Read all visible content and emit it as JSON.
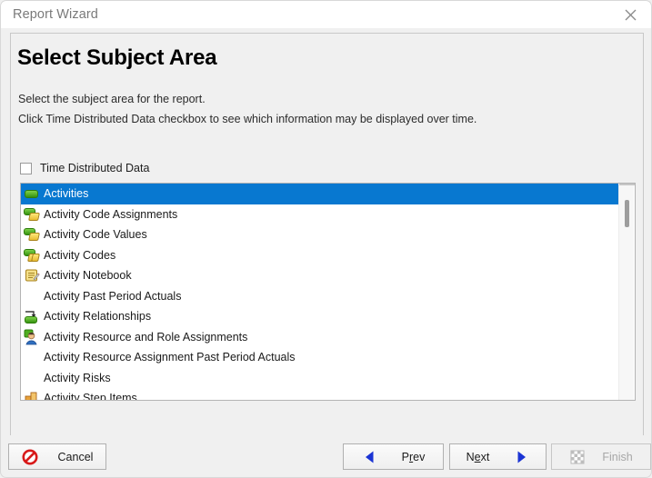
{
  "window": {
    "title": "Report Wizard",
    "close_icon": "close-icon"
  },
  "page": {
    "heading": "Select Subject Area",
    "instruction_line_1": "Select the subject area for the report.",
    "instruction_line_2": "Click Time Distributed Data checkbox to see which information may be displayed over time."
  },
  "checkbox": {
    "label": "Time Distributed Data",
    "checked": false
  },
  "list": {
    "selected_index": 0,
    "items": [
      {
        "label": "Activities",
        "icon": "activity-bar-icon",
        "selected": true
      },
      {
        "label": "Activity Code Assignments",
        "icon": "activity-code-assignment-icon",
        "selected": false
      },
      {
        "label": "Activity Code Values",
        "icon": "activity-code-value-icon",
        "selected": false
      },
      {
        "label": "Activity Codes",
        "icon": "activity-code-icon",
        "selected": false
      },
      {
        "label": "Activity Notebook",
        "icon": "notebook-icon",
        "selected": false
      },
      {
        "label": "Activity Past Period Actuals",
        "icon": "none",
        "selected": false
      },
      {
        "label": "Activity Relationships",
        "icon": "relationship-icon",
        "selected": false
      },
      {
        "label": "Activity Resource and Role Assignments",
        "icon": "resource-role-icon",
        "selected": false
      },
      {
        "label": "Activity Resource Assignment Past Period Actuals",
        "icon": "none",
        "selected": false
      },
      {
        "label": "Activity Risks",
        "icon": "none",
        "selected": false
      },
      {
        "label": "Activity Step Items",
        "icon": "step-item-icon",
        "selected": false
      }
    ]
  },
  "buttons": {
    "cancel": {
      "label": "Cancel",
      "icon": "cancel-prohibition-icon",
      "disabled": false
    },
    "prev": {
      "label_pre": "P",
      "label_accel": "r",
      "label_post": "ev",
      "icon": "left-triangle-icon",
      "disabled": false
    },
    "next": {
      "label_pre": "N",
      "label_accel": "e",
      "label_post": "xt",
      "icon": "right-triangle-icon",
      "disabled": false
    },
    "finish": {
      "label": "Finish",
      "icon": "checker-icon",
      "disabled": true
    }
  },
  "scrollbar": {
    "orientation": "vertical",
    "thumb_position": "top"
  },
  "colors": {
    "selection_blue": "#0878d0",
    "window_bg": "#f0f0f0",
    "list_bg": "#ffffff",
    "accent_red": "#e02020",
    "accent_blue": "#1b34d4",
    "icon_green": "#35920f",
    "icon_yellow": "#e8bd32"
  }
}
